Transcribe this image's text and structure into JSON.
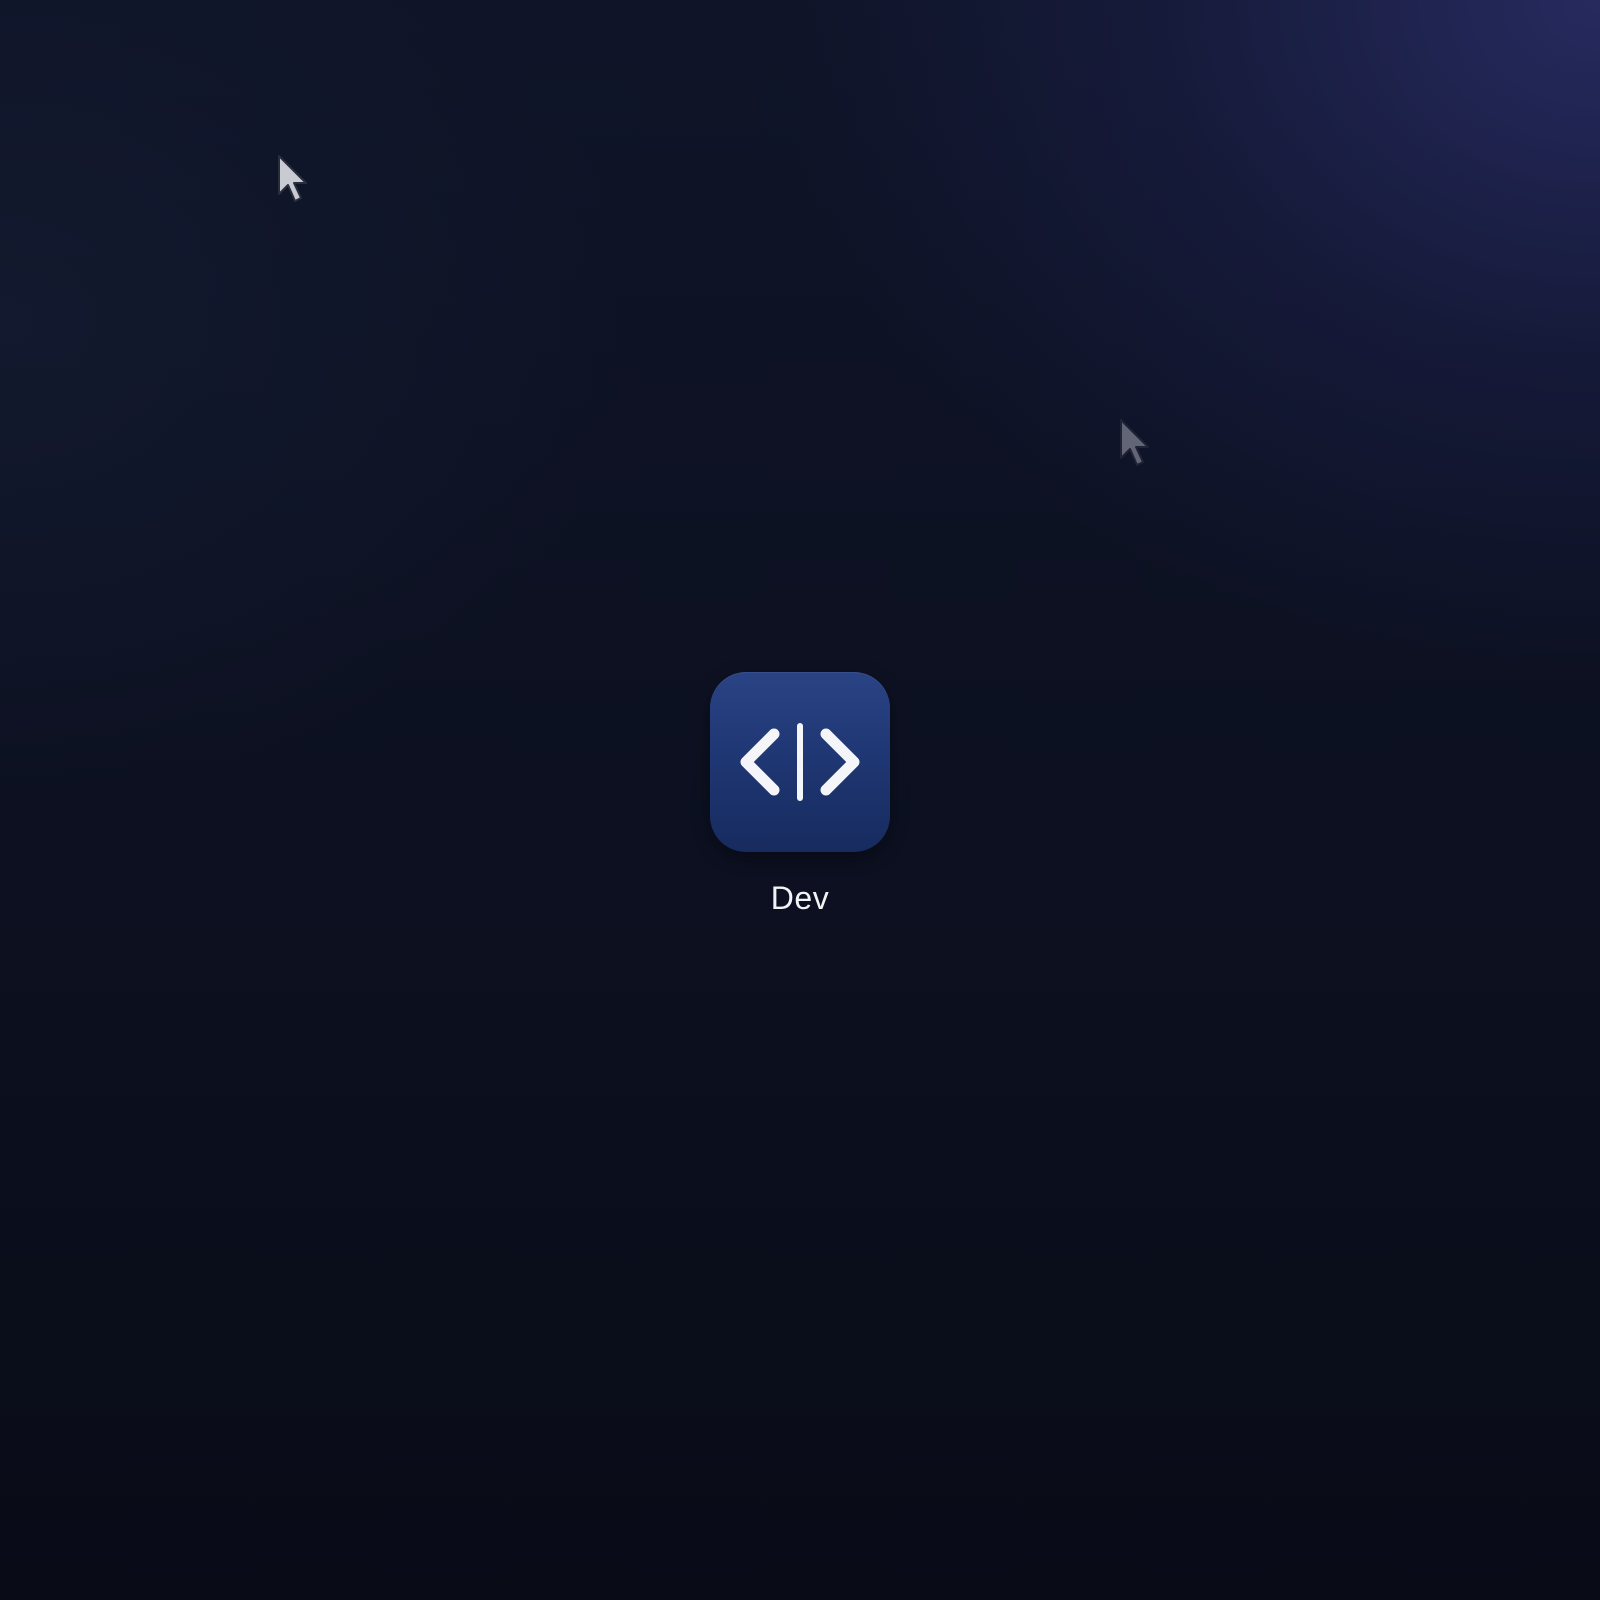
{
  "desktop": {
    "app": {
      "label": "Dev",
      "icon": "code-brackets-icon",
      "icon_color": "#1f3774"
    },
    "cursors": [
      {
        "icon": "mouse-pointer-icon",
        "state": "active"
      },
      {
        "icon": "mouse-pointer-icon",
        "state": "faded"
      }
    ],
    "colors": {
      "background": "#0b0f1d",
      "accent_glow": "#2a2e68",
      "label_text": "#f2f3f7"
    }
  }
}
